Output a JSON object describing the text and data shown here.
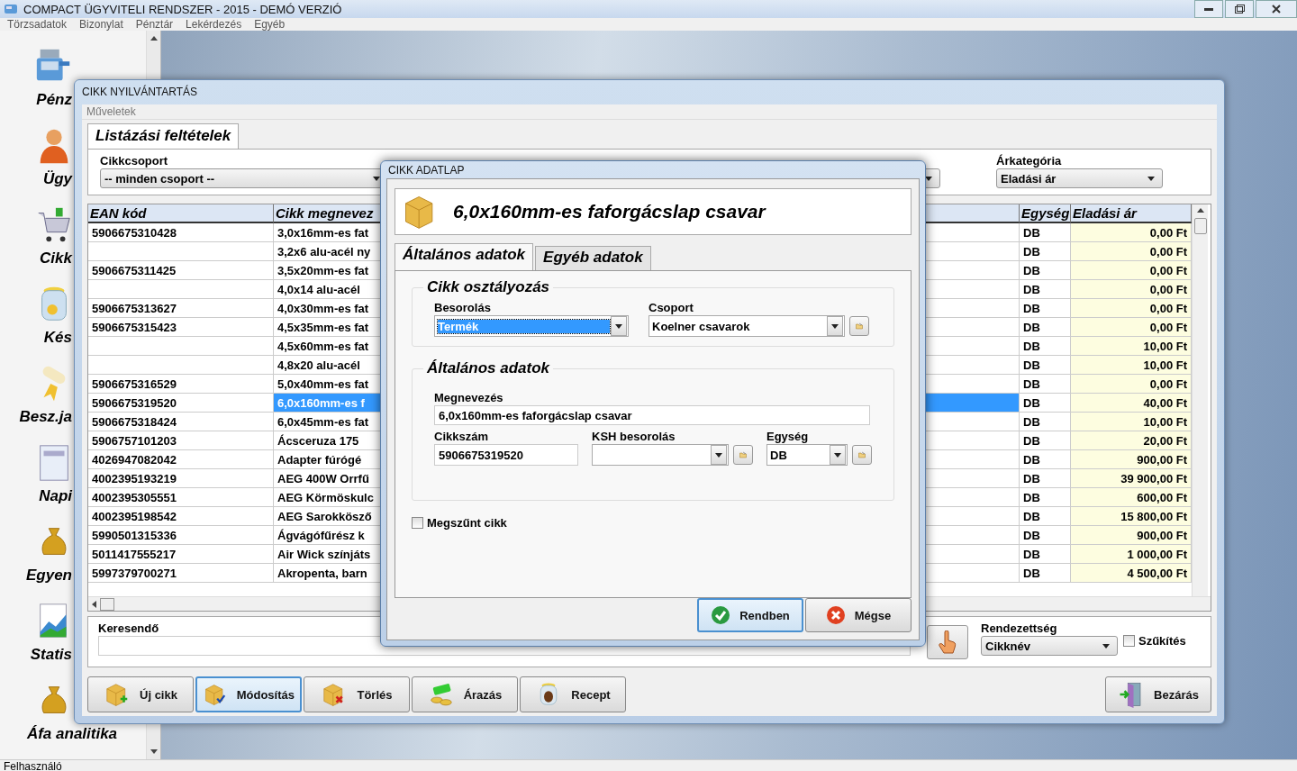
{
  "window": {
    "title": "COMPACT ÜGYVITELI RENDSZER - 2015 - DEMÓ VERZIÓ"
  },
  "menu": [
    "Törzsadatok",
    "Bizonylat",
    "Pénztár",
    "Lekérdezés",
    "Egyéb"
  ],
  "sidebar": {
    "items": [
      {
        "label": "Pénz"
      },
      {
        "label": "Ügy"
      },
      {
        "label": "Cikk"
      },
      {
        "label": "Kés"
      },
      {
        "label": "Besz.ja"
      },
      {
        "label": "Napi"
      },
      {
        "label": "Egyen"
      },
      {
        "label": "Statis"
      },
      {
        "label": "Áfa analitika"
      }
    ]
  },
  "list_window": {
    "title": "CIKK NYILVÁNTARTÁS",
    "menu": [
      "Műveletek"
    ],
    "tabs": [
      {
        "label": "Listázási feltételek",
        "selected": true
      }
    ],
    "group_filter": {
      "label": "Cikkcsoport",
      "value": "-- minden csoport --"
    },
    "price_filter": {
      "label": "Árkategória",
      "value": "Eladási ár"
    },
    "table": {
      "columns": [
        "EAN kód",
        "Cikk megnevez",
        "Egység",
        "Eladási ár"
      ],
      "rows": [
        {
          "ean": "5906675310428",
          "name": "3,0x16mm-es fat",
          "unit": "DB",
          "price": "0,00 Ft",
          "selected": false
        },
        {
          "name": "3,2x6 alu-acél ny",
          "unit": "DB",
          "price": "0,00 Ft",
          "selected": false
        },
        {
          "ean": "5906675311425",
          "name": "3,5x20mm-es fat",
          "unit": "DB",
          "price": "0,00 Ft",
          "selected": false
        },
        {
          "name": "4,0x14 alu-acél",
          "unit": "DB",
          "price": "0,00 Ft",
          "selected": false
        },
        {
          "ean": "5906675313627",
          "name": "4,0x30mm-es fat",
          "unit": "DB",
          "price": "0,00 Ft",
          "selected": false
        },
        {
          "ean": "5906675315423",
          "name": "4,5x35mm-es fat",
          "unit": "DB",
          "price": "0,00 Ft",
          "selected": false
        },
        {
          "name": "4,5x60mm-es fat",
          "unit": "DB",
          "price": "10,00 Ft",
          "selected": false
        },
        {
          "name": "4,8x20 alu-acél",
          "unit": "DB",
          "price": "10,00 Ft",
          "selected": false
        },
        {
          "ean": "5906675316529",
          "name": "5,0x40mm-es fat",
          "unit": "DB",
          "price": "0,00 Ft",
          "selected": false
        },
        {
          "ean": "5906675319520",
          "name": "6,0x160mm-es f",
          "unit": "DB",
          "price": "40,00 Ft",
          "selected": true
        },
        {
          "ean": "5906675318424",
          "name": "6,0x45mm-es fat",
          "unit": "DB",
          "price": "10,00 Ft",
          "selected": false
        },
        {
          "ean": "5906757101203",
          "name": "Ácsceruza 175",
          "unit": "DB",
          "price": "20,00 Ft",
          "selected": false
        },
        {
          "ean": "4026947082042",
          "name": "Adapter fúrógé",
          "unit": "DB",
          "price": "900,00 Ft",
          "selected": false
        },
        {
          "ean": "4002395193219",
          "name": "AEG 400W Orrfű",
          "unit": "DB",
          "price": "39 900,00 Ft",
          "selected": false
        },
        {
          "ean": "4002395305551",
          "name": "AEG Körmöskulc",
          "unit": "DB",
          "price": "600,00 Ft",
          "selected": false
        },
        {
          "ean": "4002395198542",
          "name": "AEG Sarokkösző",
          "unit": "DB",
          "price": "15 800,00 Ft",
          "selected": false
        },
        {
          "ean": "5990501315336",
          "name": "Ágvágófűrész k",
          "unit": "DB",
          "price": "900,00 Ft",
          "selected": false
        },
        {
          "ean": "5011417555217",
          "name": "Air Wick színjáts",
          "unit": "DB",
          "price": "1 000,00 Ft",
          "selected": false
        },
        {
          "ean": "5997379700271",
          "name": "Akropenta, barn",
          "unit": "DB",
          "price": "4 500,00 Ft",
          "selected": false
        }
      ]
    },
    "search": {
      "label": "Keresendő"
    },
    "sort": {
      "label": "Rendezettség",
      "value": "Cikknév"
    },
    "narrow": {
      "label": "Szűkítés",
      "checked": false
    },
    "buttons": [
      {
        "label": "Új cikk",
        "selected": false
      },
      {
        "label": "Módosítás",
        "selected": true
      },
      {
        "label": "Törlés",
        "selected": false
      },
      {
        "label": "Árazás",
        "selected": false
      },
      {
        "label": "Recept",
        "selected": false
      }
    ],
    "close_button": "Bezárás"
  },
  "dialog": {
    "title": "CIKK ADATLAP",
    "heading": "6,0x160mm-es faforgácslap csavar",
    "tabs": [
      {
        "label": "Általános adatok",
        "selected": true
      },
      {
        "label": "Egyéb adatok",
        "selected": false
      }
    ],
    "classification": {
      "title": "Cikk osztályozás",
      "category": {
        "label": "Besorolás",
        "value": "Termék"
      },
      "group": {
        "label": "Csoport",
        "value": "Koelner csavarok"
      }
    },
    "general": {
      "title": "Általános adatok",
      "name": {
        "label": "Megnevezés",
        "value": "6,0x160mm-es faforgácslap csavar"
      },
      "code": {
        "label": "Cikkszám",
        "value": "5906675319520"
      },
      "ksh": {
        "label": "KSH besorolás"
      },
      "unit": {
        "label": "Egység",
        "value": "DB"
      }
    },
    "discontinued": {
      "label": "Megszűnt cikk",
      "checked": false
    },
    "buttons": [
      {
        "label": "Rendben",
        "kind": "ok",
        "focused": true
      },
      {
        "label": "Mégse",
        "kind": "cancel",
        "focused": false
      }
    ]
  },
  "status_bar": "Felhasználó"
}
